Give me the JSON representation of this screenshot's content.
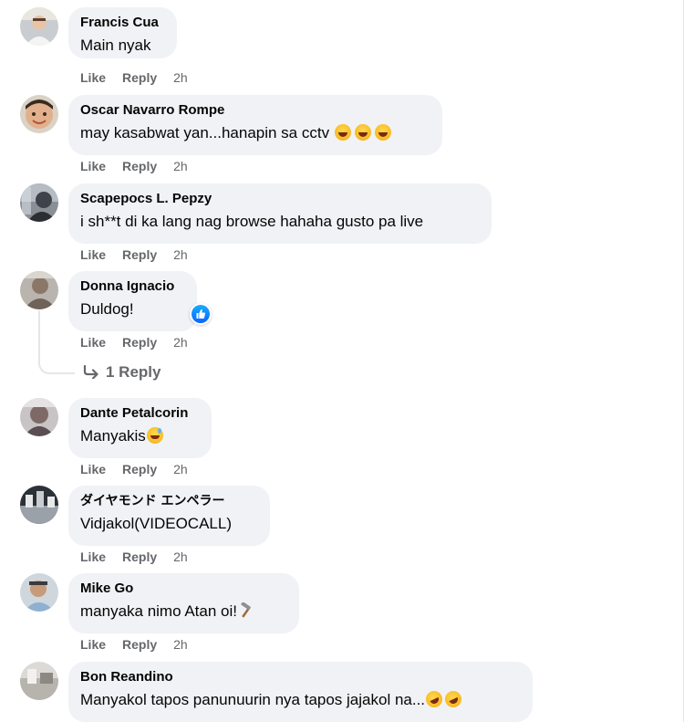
{
  "comments": [
    {
      "author": "Francis Cua",
      "text": "Main nyak",
      "actions": {
        "like": "Like",
        "reply": "Reply",
        "time": "2h"
      },
      "emoji": []
    },
    {
      "author": "Oscar Navarro Rompe",
      "text": "may kasabwat yan...hanapin sa cctv ",
      "actions": {
        "like": "Like",
        "reply": "Reply",
        "time": "2h"
      },
      "emoji": [
        "laughing-tears-emoji",
        "laughing-tears-emoji",
        "laughing-tears-emoji"
      ]
    },
    {
      "author": "Scapepocs L. Pepzy",
      "text": "i sh**t di ka lang nag browse hahaha gusto pa live",
      "actions": {
        "like": "Like",
        "reply": "Reply",
        "time": "2h"
      },
      "emoji": []
    },
    {
      "author": "Donna Ignacio",
      "text": "Duldog!",
      "actions": {
        "like": "Like",
        "reply": "Reply",
        "time": "2h"
      },
      "reaction": "like-reaction-icon",
      "replies_label": "1 Reply"
    },
    {
      "author": "Dante Petalcorin",
      "text": "Manyakis",
      "actions": {
        "like": "Like",
        "reply": "Reply",
        "time": "2h"
      },
      "emoji": [
        "sweat-smile-emoji"
      ]
    },
    {
      "author": "ダイヤモンド エンペラー",
      "text": "Vidjakol(VIDEOCALL)",
      "actions": {
        "like": "Like",
        "reply": "Reply",
        "time": "2h"
      },
      "emoji": []
    },
    {
      "author": "Mike Go",
      "text": "manyaka nimo Atan oi!",
      "actions": {
        "like": "Like",
        "reply": "Reply",
        "time": "2h"
      },
      "emoji": [
        "hammer-emoji"
      ]
    },
    {
      "author": "Bon Reandino",
      "text": "Manyakol tapos panunuurin nya tapos jajakol na...",
      "actions": {
        "like": "Like",
        "reply": "Reply",
        "time": "2h"
      },
      "emoji": [
        "rofl-emoji",
        "rofl-emoji"
      ]
    }
  ],
  "colors": {
    "bubble_bg": "#f0f2f5",
    "action_text": "#65676b",
    "author_text": "#050505",
    "like_blue": "#0866ff"
  }
}
